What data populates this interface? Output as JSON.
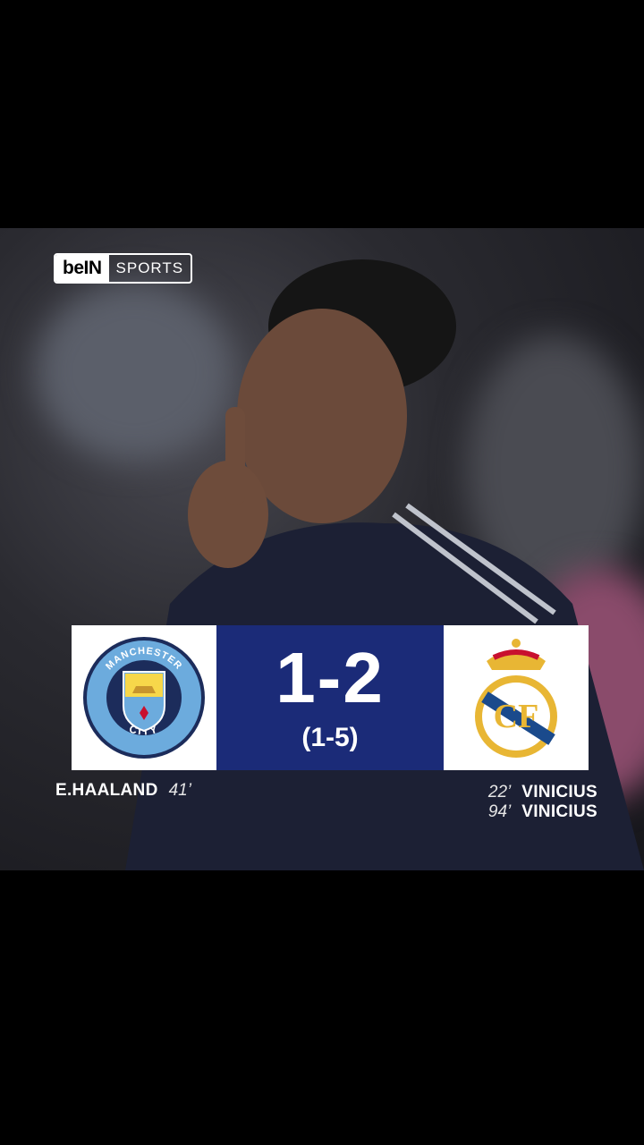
{
  "broadcaster": {
    "logo_text": "beIN",
    "sports_text": "SPORTS"
  },
  "match": {
    "home_team": {
      "crest": "manchester-city-crest",
      "crest_text_top": "MANCHESTER",
      "crest_text_bottom": "CITY"
    },
    "away_team": {
      "crest": "real-madrid-crest"
    },
    "score": "1-2",
    "aggregate": "(1-5)"
  },
  "home_scorers": [
    {
      "name": "E.HAALAND",
      "minute": "41’"
    }
  ],
  "away_scorers": [
    {
      "minute": "22’",
      "name": "VINICIUS"
    },
    {
      "minute": "94’",
      "name": "VINICIUS"
    }
  ],
  "colors": {
    "scoreboard_blue": "#1b2b78",
    "city_blue": "#6cabdd",
    "madrid_gold": "#e8b634"
  }
}
